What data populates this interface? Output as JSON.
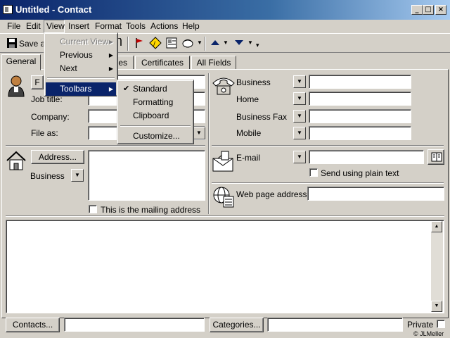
{
  "window": {
    "title": "Untitled - Contact"
  },
  "menubar": {
    "items": [
      "File",
      "Edit",
      "View",
      "Insert",
      "Format",
      "Tools",
      "Actions",
      "Help"
    ]
  },
  "toolbar": {
    "save_label": "Save a"
  },
  "tabs": [
    "General",
    "es",
    "Certificates",
    "All Fields"
  ],
  "view_menu": {
    "items": [
      {
        "label": "Current View",
        "state": "disabled"
      },
      {
        "label": "Previous",
        "state": "normal"
      },
      {
        "label": "Next",
        "state": "normal"
      },
      {
        "label": "Toolbars",
        "state": "highlighted"
      }
    ]
  },
  "toolbars_submenu": {
    "items": [
      {
        "label": "Standard",
        "checked": true
      },
      {
        "label": "Formatting",
        "checked": false
      },
      {
        "label": "Clipboard",
        "checked": false
      },
      {
        "label": "Customize...",
        "checked": false
      }
    ]
  },
  "form": {
    "name_button": "F",
    "job_title_label": "Job title:",
    "company_label": "Company:",
    "file_as_label": "File as:",
    "address_button": "Address...",
    "address_type": "Business",
    "mailing_checkbox_label": "This is the mailing address",
    "phones": [
      {
        "label": "Business",
        "value": ""
      },
      {
        "label": "Home",
        "value": ""
      },
      {
        "label": "Business Fax",
        "value": ""
      },
      {
        "label": "Mobile",
        "value": ""
      }
    ],
    "email_label": "E-mail",
    "plain_text_label": "Send using plain text",
    "webpage_label": "Web page address:",
    "contacts_button": "Contacts...",
    "categories_button": "Categories...",
    "private_label": "Private"
  },
  "footer": {
    "copyright": "© JLMeller"
  },
  "colors": {
    "titlebar_start": "#0a246a",
    "titlebar_end": "#a6caf0",
    "highlight": "#0a246a",
    "face": "#d4d0c8"
  }
}
